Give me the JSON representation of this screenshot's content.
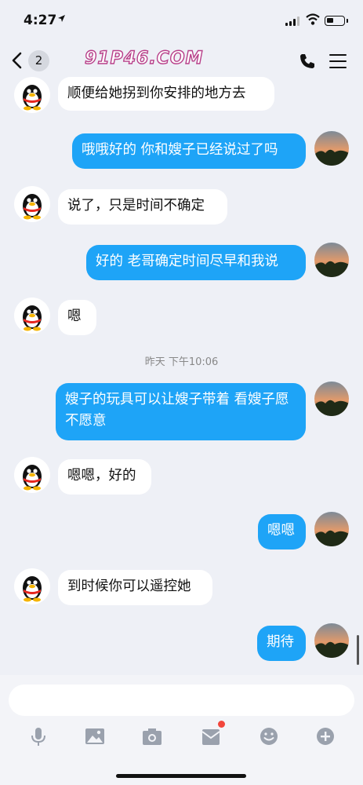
{
  "status_bar": {
    "time": "4:27"
  },
  "nav": {
    "unread_count": "2",
    "watermark": "91P46.COM"
  },
  "messages": [
    {
      "side": "in",
      "text": "顺便给她拐到你安排的地方去"
    },
    {
      "side": "out",
      "text": "哦哦好的 你和嫂子已经说过了吗"
    },
    {
      "side": "in",
      "text": "说了，只是时间不确定"
    },
    {
      "side": "out",
      "text": "好的 老哥确定时间尽早和我说"
    },
    {
      "side": "in",
      "text": "嗯"
    },
    {
      "side": "out",
      "text": "嫂子的玩具可以让嫂子带着 看嫂子愿不愿意"
    },
    {
      "side": "in",
      "text": "嗯嗯，好的"
    },
    {
      "side": "out",
      "text": "嗯嗯"
    },
    {
      "side": "in",
      "text": "到时候你可以遥控她"
    },
    {
      "side": "out",
      "text": "期待"
    }
  ],
  "timestamp": "昨天 下午10:06",
  "input": {
    "value": "",
    "placeholder": ""
  },
  "toolbar": {
    "icons": [
      "microphone-icon",
      "image-icon",
      "camera-icon",
      "red-packet-icon",
      "emoji-icon",
      "plus-icon"
    ]
  },
  "colors": {
    "outgoing_bubble": "#1ea4f7",
    "incoming_bubble": "#ffffff",
    "background": "#eef0f6",
    "notification_dot": "#f2463c"
  }
}
